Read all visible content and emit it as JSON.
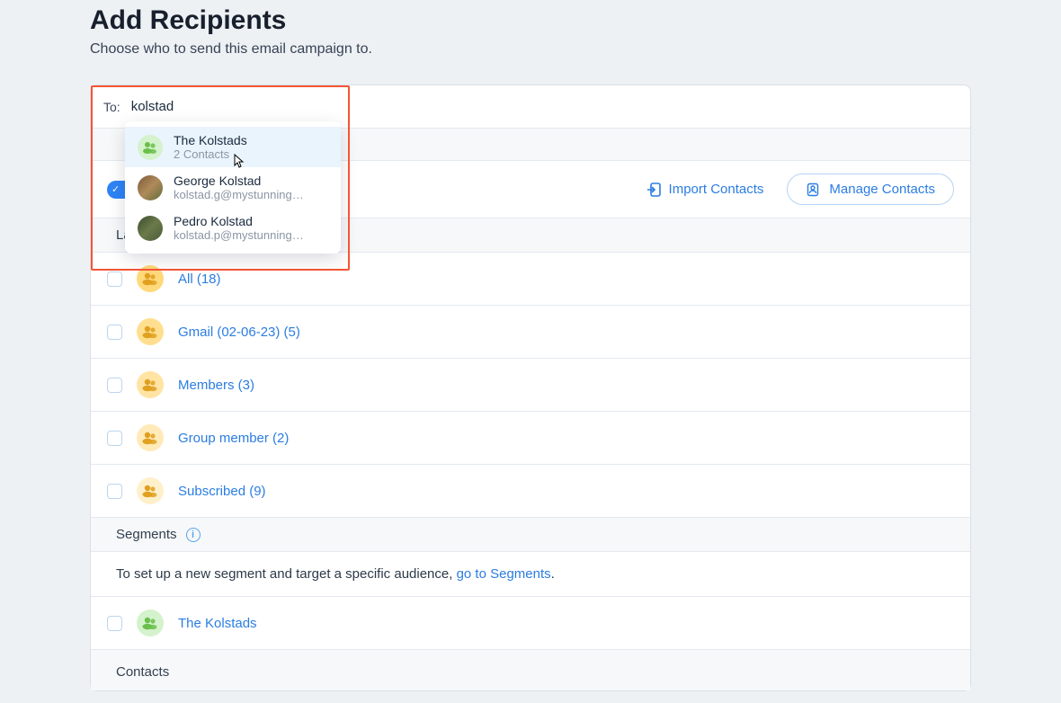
{
  "header": {
    "title": "Add Recipients",
    "subtitle": "Choose who to send this email campaign to."
  },
  "to": {
    "label": "To:",
    "value": "kolstad"
  },
  "dropdown": [
    {
      "primary": "The Kolstads",
      "secondary": "2 Contacts",
      "kind": "group"
    },
    {
      "primary": "George Kolstad",
      "secondary": "kolstad.g@mystunning…",
      "kind": "photo1"
    },
    {
      "primary": "Pedro Kolstad",
      "secondary": "kolstad.p@mystunning…",
      "kind": "photo2"
    }
  ],
  "toolbar": {
    "import": "Import Contacts",
    "manage": "Manage Contacts"
  },
  "sections": {
    "labels": "Labels",
    "segments": "Segments",
    "contacts": "Contacts"
  },
  "labels": [
    {
      "text": "All (18)",
      "shade": "lv0"
    },
    {
      "text": "Gmail (02-06-23) (5)",
      "shade": "lv1"
    },
    {
      "text": "Members (3)",
      "shade": "lv2"
    },
    {
      "text": "Group member (2)",
      "shade": "lv3"
    },
    {
      "text": "Subscribed (9)",
      "shade": "lv4"
    }
  ],
  "segments_note": {
    "prefix": "To set up a new segment and target a specific audience, ",
    "link": "go to Segments",
    "suffix": "."
  },
  "segments": [
    {
      "text": "The Kolstads"
    }
  ]
}
